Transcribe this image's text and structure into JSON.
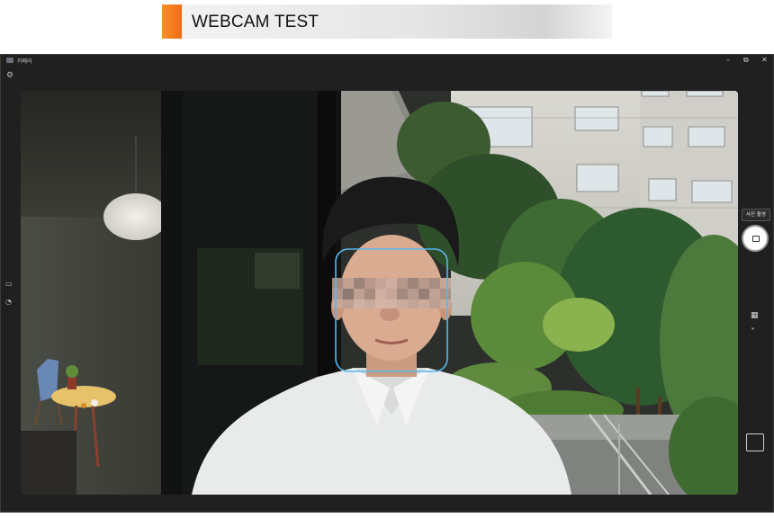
{
  "banner": {
    "title": "WEBCAM TEST"
  },
  "window": {
    "app_title": "카메라",
    "minimize_glyph": "–",
    "maximize_glyph": "⧉",
    "close_glyph": "✕"
  },
  "controls": {
    "settings_glyph": "⚙",
    "chevron_up_glyph": "˄",
    "chevron_down_glyph": "˅",
    "photo_mode_tooltip": "사진 촬영",
    "qr_glyph": "▦",
    "left_icon1_glyph": "▭",
    "left_icon2_glyph": "◔"
  },
  "colors": {
    "accent_orange": "#f7921e",
    "face_box": "#57b8ee",
    "window_bg": "#202020"
  }
}
